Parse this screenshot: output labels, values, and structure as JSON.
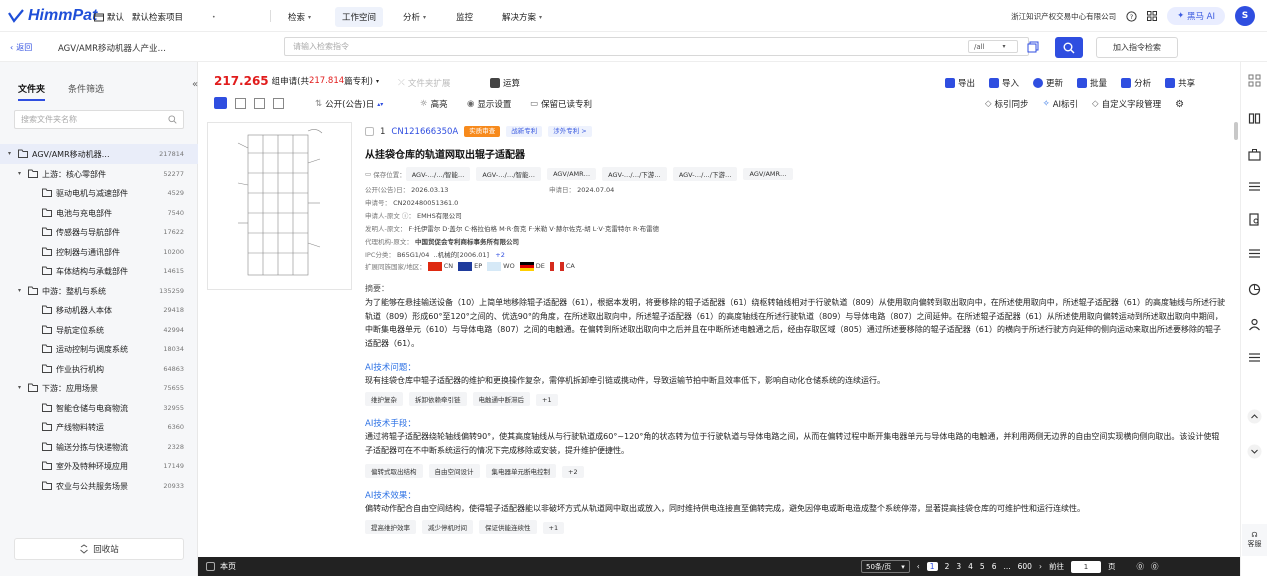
{
  "brand": {
    "logo": "HimmPat",
    "colors": {
      "accent": "#2f4ee0",
      "red": "#e11c1c",
      "orange": "#f78a1c",
      "dark_bar": "#222222"
    }
  },
  "topnav": {
    "default_label": "默认",
    "project": "默认检索项目",
    "items": [
      "检索",
      "工作空间",
      "分析",
      "监控",
      "解决方案"
    ],
    "org": "浙江知识产权交易中心有限公司",
    "ai_button": "黑马 AI",
    "avatar": "S"
  },
  "searchbar": {
    "back": "返回",
    "page_title": "AGV/AMR移动机器人产业…",
    "placeholder": "请输入检索指令",
    "scope": "/all",
    "add_button": "加入指令检索"
  },
  "sidebar": {
    "tabs": [
      "文件夹",
      "条件筛选"
    ],
    "filter_placeholder": "搜索文件夹名称",
    "recycle": "回收站",
    "tree": [
      {
        "label": "AGV/AMR移动机器…",
        "count": "217814",
        "level": 0,
        "caret": true,
        "selected": true
      },
      {
        "label": "上游：核心零部件",
        "count": "52277",
        "level": 1,
        "caret": true
      },
      {
        "label": "驱动电机与减速部件",
        "count": "4529",
        "level": 2
      },
      {
        "label": "电池与充电部件",
        "count": "7540",
        "level": 2
      },
      {
        "label": "传感器与导航部件",
        "count": "17622",
        "level": 2
      },
      {
        "label": "控制器与通讯部件",
        "count": "10200",
        "level": 2
      },
      {
        "label": "车体结构与承载部件",
        "count": "14615",
        "level": 2
      },
      {
        "label": "中游：整机与系统",
        "count": "135259",
        "level": 1,
        "caret": true
      },
      {
        "label": "移动机器人本体",
        "count": "29418",
        "level": 2
      },
      {
        "label": "导航定位系统",
        "count": "42994",
        "level": 2
      },
      {
        "label": "运动控制与调度系统",
        "count": "18034",
        "level": 2
      },
      {
        "label": "作业执行机构",
        "count": "64863",
        "level": 2
      },
      {
        "label": "下游：应用场景",
        "count": "75655",
        "level": 1,
        "caret": true
      },
      {
        "label": "智能仓储与电商物流",
        "count": "32955",
        "level": 2
      },
      {
        "label": "产线物料转运",
        "count": "6360",
        "level": 2
      },
      {
        "label": "输送分拣与快递物流",
        "count": "2328",
        "level": 2
      },
      {
        "label": "室外及特种环境应用",
        "count": "17149",
        "level": 2
      },
      {
        "label": "农业与公共服务场景",
        "count": "20933",
        "level": 2
      }
    ]
  },
  "toolbar": {
    "count_big": "217.265",
    "count_unit": "组申请(共",
    "count_red": "217.814",
    "count_tail": "篇专利)",
    "folder_expand": "文件夹扩展",
    "operate": "运算",
    "export": "导出",
    "import": "导入",
    "update": "更新",
    "batch": "批量",
    "analyze": "分析",
    "share": "共享",
    "sort": "公开(公告)日",
    "highlight": "高亮",
    "display": "显示设置",
    "keep_read": "保留已读专利",
    "tag_sync": "标引同步",
    "ai_tag": "AI标引",
    "custom_field": "自定义字段管理"
  },
  "patent": {
    "index": "1",
    "number": "CN121666350A",
    "tags": [
      "实质审查",
      "战新专利",
      "涉外专利 >"
    ],
    "title": "从挂袋仓库的轨道网取出辊子适配器",
    "save_label": "保存位置：",
    "save_paths": [
      "AGV-…/…/智能…",
      "AGV-…/…/智能…",
      "AGV/AMR…",
      "AGV-…/…/下游…",
      "AGV-…/…/下游…",
      "AGV/AMR…"
    ],
    "pub_date_label": "公开(公告)日：",
    "pub_date": "2026.03.13",
    "app_date_label": "申请日：",
    "app_date": "2024.07.04",
    "app_no_label": "申请号：",
    "app_no": "CN202480051361.0",
    "applicant_label": "申请人-原文",
    "applicant": "EMHS有限公司",
    "inventor_label": "发明人-原文：",
    "inventors": "F·托伊雷尔 D·盖尔 C·格拉伯格 M·R·詹克 F·米勒 V·赫尔佐克-胡 L·V·克雷特尔 R·布雷德",
    "agent_label": "代理机构-原文：",
    "agent": "中国贸促会专利商标事务所有限公司",
    "ipc_label": "IPC分类：",
    "ipc": "B65G1/04",
    "ipc_desc": "..机械的[2006.01]",
    "ipc_more": "+2",
    "family_label": "扩展同族国家/地区：",
    "family": [
      "CN",
      "EP",
      "WO",
      "DE",
      "CA"
    ],
    "abstract_label": "摘要：",
    "abstract": "为了能够在悬挂输送设备（10）上简单地移除辊子适配器（61），根据本发明，将要移除的辊子适配器（61）绕枢转轴线相对于行驶轨道（809）从使用取向偏转到取出取向中，在所述使用取向中，所述辊子适配器（61）的高度轴线与所述行驶轨道（809）形成60°至120°之间的、优选90°的角度，在所述取出取向中，所述辊子适配器（61）的高度轴线在所述行驶轨道（809）与导体电路（807）之间延伸。在所述辊子适配器（61）从所述使用取向偏转运动到所述取出取向中期间，中断集电器单元（610）与导体电路（807）之间的电触通。在偏转到所述取出取向中之后并且在中断所述电触通之后，经由存取区域（805）通过所述要移除的辊子适配器（61）的横向于所述行驶方向延伸的侧向运动来取出所述要移除的辊子适配器（61）。",
    "ai_problem_label": "AI技术问题：",
    "ai_problem": "现有挂袋仓库中辊子适配器的维护和更换操作复杂，需停机拆卸牵引链或携动件，导致运输节拍中断且效率低下，影响自动化仓储系统的连续运行。",
    "ai_problem_chips": [
      "维护复杂",
      "拆卸依赖牵引链",
      "电触通中断滞后",
      "+1"
    ],
    "ai_means_label": "AI技术手段：",
    "ai_means": "通过将辊子适配器绕轮轴线偏转90°，使其高度轴线从与行驶轨道成60°~120°角的状态转为位于行驶轨道与导体电路之间，从而在偏转过程中断开集电器单元与导体电路的电触通，并利用两侧无边界的自由空间实现横向侧向取出。该设计使辊子适配器可在不中断系统运行的情况下完成移除或安装，提升维护便捷性。",
    "ai_means_chips": [
      "偏转式取出结构",
      "自由空间设计",
      "集电器单元断电控制",
      "+2"
    ],
    "ai_effect_label": "AI技术效果：",
    "ai_effect": "偏转动作配合自由空间结构，使得辊子适配器能以非破坏方式从轨道网中取出或放入，同时维持供电连接直至偏转完成，避免因停电或断电造成整个系统停滞，显著提高挂袋仓库的可维护性和运行连续性。",
    "ai_effect_chips": [
      "提高维护效率",
      "减少停机时间",
      "保证供能连续性",
      "+1"
    ]
  },
  "bottombar": {
    "this_page": "本页",
    "per_page": "50条/页",
    "pages": [
      "1",
      "2",
      "3",
      "4",
      "5",
      "6",
      "...",
      "600"
    ],
    "goto": "前往",
    "goto_value": "1",
    "page_unit": "页"
  },
  "rail": {
    "service": "客服"
  }
}
